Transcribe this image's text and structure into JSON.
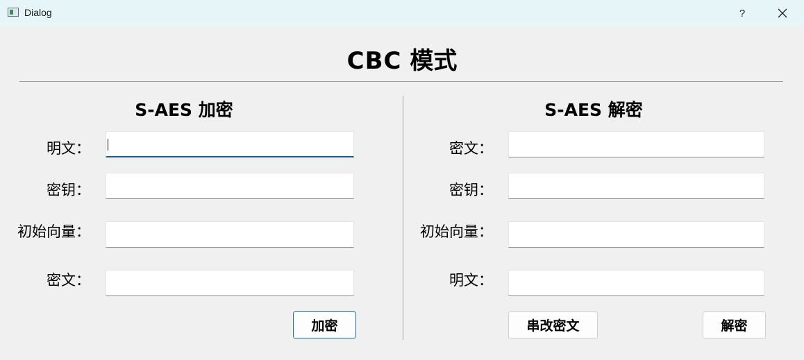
{
  "window": {
    "title": "Dialog",
    "help_label": "?"
  },
  "header": {
    "title_latin": "CBC",
    "title_cjk": "模式"
  },
  "encrypt": {
    "title_latin": "S-AES",
    "title_cjk": "加密",
    "plaintext_label": "明文：",
    "plaintext_value": "",
    "key_label": "密钥：",
    "key_value": "",
    "iv_label": "初始向量：",
    "iv_value": "",
    "ciphertext_label": "密文：",
    "ciphertext_value": "",
    "encrypt_button": "加密"
  },
  "decrypt": {
    "title_latin": "S-AES",
    "title_cjk": "解密",
    "ciphertext_label": "密文：",
    "ciphertext_value": "",
    "key_label": "密钥：",
    "key_value": "",
    "iv_label": "初始向量：",
    "iv_value": "",
    "plaintext_label": "明文：",
    "plaintext_value": "",
    "tamper_button": "串改密文",
    "decrypt_button": "解密"
  },
  "colors": {
    "accent": "#0a5ea8",
    "titlebar": "#e6f6f8",
    "background": "#f0f0f0"
  }
}
